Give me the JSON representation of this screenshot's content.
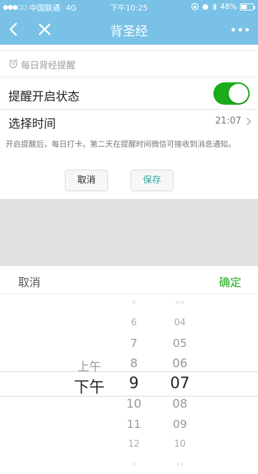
{
  "status_bar": {
    "signal": "●●●○○",
    "carrier": "中国联通",
    "network": "4G",
    "time": "下午10:25",
    "battery_text": "48%",
    "battery_level": 0.48
  },
  "nav": {
    "title": "背圣经",
    "more": "•••"
  },
  "reminder": {
    "section_title": "每日背经提醒",
    "enable_label": "提醒开启状态",
    "enabled": true,
    "time_label": "选择时间",
    "time_value": "21:07",
    "note": "开启提醒后，每日打卡，第二天在提醒时间微信可接收到消息通知。",
    "cancel_label": "取消",
    "save_label": "保存"
  },
  "picker": {
    "cancel_label": "取消",
    "confirm_label": "确定",
    "ampm": {
      "options": [
        "上午",
        "下午"
      ],
      "selected": "下午"
    },
    "hours": {
      "options": [
        "5",
        "6",
        "7",
        "8",
        "9",
        "10",
        "11",
        "12",
        "1"
      ],
      "selected": "9"
    },
    "minutes": {
      "options": [
        "03",
        "04",
        "05",
        "06",
        "07",
        "08",
        "09",
        "10",
        "11"
      ],
      "selected": "07"
    }
  }
}
